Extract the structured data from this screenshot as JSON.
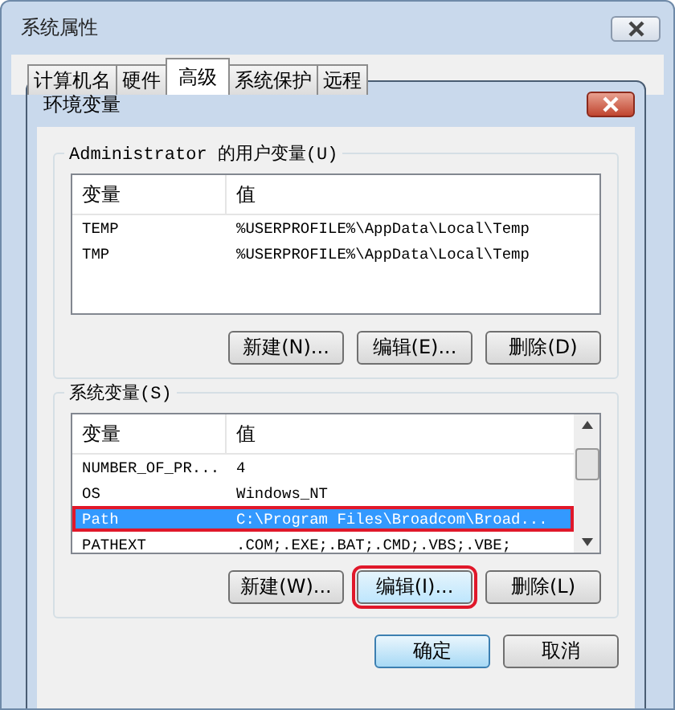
{
  "window": {
    "title": "系统属性"
  },
  "tabs": [
    {
      "label": "计算机名",
      "selected": false
    },
    {
      "label": "硬件",
      "selected": false
    },
    {
      "label": "高级",
      "selected": true
    },
    {
      "label": "系统保护",
      "selected": false
    },
    {
      "label": "远程",
      "selected": false
    }
  ],
  "dialog": {
    "title": "环境变量",
    "user_variables": {
      "label": "Administrator 的用户变量(U)",
      "columns": [
        "变量",
        "值"
      ],
      "rows": [
        {
          "name": "TEMP",
          "value": "%USERPROFILE%\\AppData\\Local\\Temp",
          "selected": false,
          "annotated": false
        },
        {
          "name": "TMP",
          "value": "%USERPROFILE%\\AppData\\Local\\Temp",
          "selected": false,
          "annotated": false
        }
      ],
      "buttons": [
        {
          "label": "新建(N)...",
          "annotated": false
        },
        {
          "label": "编辑(E)...",
          "annotated": false
        },
        {
          "label": "删除(D)",
          "annotated": false
        }
      ]
    },
    "system_variables": {
      "label": "系统变量(S)",
      "columns": [
        "变量",
        "值"
      ],
      "rows": [
        {
          "name": "NUMBER_OF_PR...",
          "value": "4",
          "selected": false,
          "annotated": false
        },
        {
          "name": "OS",
          "value": "Windows_NT",
          "selected": false,
          "annotated": false
        },
        {
          "name": "Path",
          "value": "C:\\Program Files\\Broadcom\\Broad...",
          "selected": true,
          "annotated": true
        },
        {
          "name": "PATHEXT",
          "value": ".COM;.EXE;.BAT;.CMD;.VBS;.VBE;",
          "selected": false,
          "annotated": false
        }
      ],
      "buttons": [
        {
          "label": "新建(W)...",
          "annotated": false
        },
        {
          "label": "编辑(I)...",
          "annotated": true
        },
        {
          "label": "删除(L)",
          "annotated": false
        }
      ]
    },
    "footer_buttons": [
      "确定",
      "取消"
    ]
  }
}
